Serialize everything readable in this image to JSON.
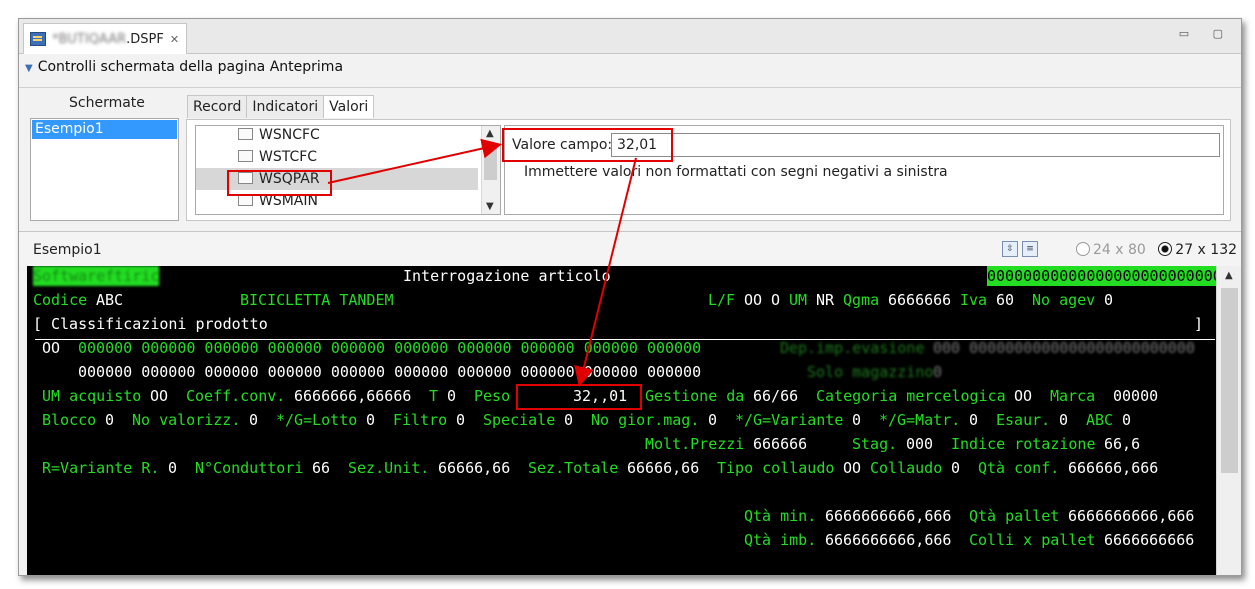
{
  "editor_tab": {
    "filename_blurred": "*BUTIQAAR",
    "filename_suffix": ".DSPF",
    "close": "✕"
  },
  "window_buttons": "▭ ▢",
  "section_title": "Controlli schermata della pagina Anteprima",
  "schermate": {
    "label": "Schermate",
    "items": [
      "Esempio1"
    ]
  },
  "tabs": [
    "Record",
    "Indicatori",
    "Valori"
  ],
  "tree_items": [
    "WSNCFC",
    "WSTCFC",
    "WSQPAR",
    "WSMAIN"
  ],
  "valore": {
    "label": "Valore campo:",
    "value": "32,01",
    "hint": "Immettere valori non formattati con segni negativi a sinistra"
  },
  "preview": {
    "title": "Esempio1",
    "radio1": "24 x 80",
    "radio2": "27 x 132"
  },
  "terminal": {
    "r1_user": "Softwareftiric",
    "r1_title": "Interrogazione articolo",
    "r1_right": "00000000000000000000000000",
    "r2": {
      "codice_lbl": "Codice",
      "codice": "ABC",
      "descr": "BICICLETTA TANDEM",
      "lf_lbl": "L/F",
      "lf": "OO",
      "o": "O",
      "um_lbl": "UM",
      "um": "NR",
      "qgma_lbl": "Qgma",
      "qgma": "6666666",
      "iva_lbl": "Iva",
      "iva": "60",
      "noagev_lbl": "No agev",
      "noagev": "0"
    },
    "r3": {
      "open": "[",
      "text": "Classificazioni prodotto",
      "close": "]"
    },
    "r4_lead": "OO",
    "r4_green": "000000 000000 000000 000000 000000 000000 000000 000000 000000 000000",
    "r4_blur_lbl": "Dep.imp.evasione",
    "r4_blur_val": "000 0000000000000000000000000",
    "r5_white": "000000 000000 000000 000000 000000 000000 000000 000000 000000 000000",
    "r5_blur_lbl": "Solo magazzino",
    "r5_blur_val": "0",
    "r6": {
      "um_acq_lbl": "UM acquisto",
      "um_acq": "OO",
      "coeff_lbl": "Coeff.conv.",
      "coeff": "6666666,66666",
      "t_lbl": "T",
      "t": "0",
      "peso_lbl": "Peso",
      "peso": "32,,01",
      "gest_lbl": "Gestione da",
      "gest": "66/66",
      "cat_lbl": "Categoria mercelogica",
      "cat": "OO",
      "marca_lbl": "Marca",
      "marca": "00000"
    },
    "r7": {
      "blocco_lbl": "Blocco",
      "blocco": "0",
      "noval_lbl": "No valorizz.",
      "noval": "0",
      "lotto_lbl": "*/G=Lotto",
      "lotto": "0",
      "filtro_lbl": "Filtro",
      "filtro": "0",
      "spec_lbl": "Speciale",
      "spec": "0",
      "nogior_lbl": "No gior.mag.",
      "nogior": "0",
      "var_lbl": "*/G=Variante",
      "var": "0",
      "matr_lbl": "*/G=Matr.",
      "matr": "0",
      "esaur_lbl": "Esaur.",
      "esaur": "0",
      "abc_lbl": "ABC",
      "abc": "0"
    },
    "r8": {
      "molt_lbl": "Molt.Prezzi",
      "molt": "666666",
      "stag_lbl": "Stag.",
      "stag": "000",
      "indice_lbl": "Indice rotazione",
      "indice": "66,6"
    },
    "r9": {
      "rvar_lbl": "R=Variante R.",
      "rvar": "0",
      "ncond_lbl": "N°Conduttori",
      "ncond": "66",
      "sezu_lbl": "Sez.Unit.",
      "sezu": "66666,66",
      "sezt_lbl": "Sez.Totale",
      "sezt": "66666,66",
      "tipo_lbl": "Tipo collaudo",
      "tipo": "OO",
      "coll_lbl": "Collaudo",
      "coll": "0",
      "qtac_lbl": "Qtà conf.",
      "qtac": "666666,666"
    },
    "r10": {
      "qmin_lbl": "Qtà min.",
      "qmin": "6666666666,666",
      "qpal_lbl": "Qtà pallet",
      "qpal": "6666666666,666"
    },
    "r11": {
      "qimb_lbl": "Qtà imb.",
      "qimb": "6666666666,666",
      "colli_lbl": "Colli x pallet",
      "colli": "6666666666"
    }
  }
}
